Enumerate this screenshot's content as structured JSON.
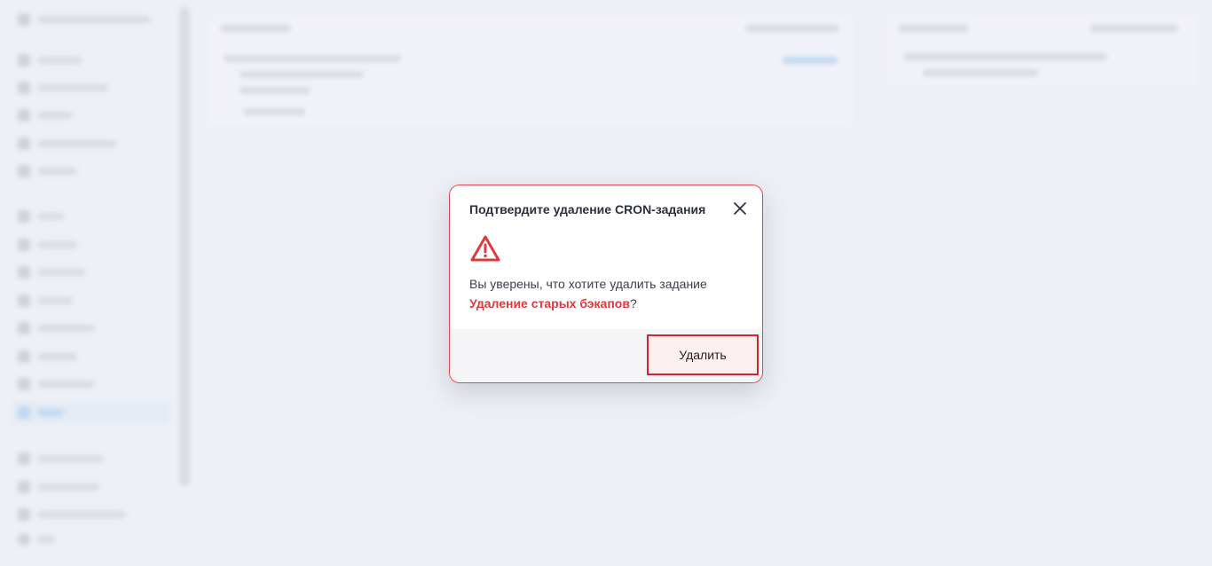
{
  "modal": {
    "title": "Подтвердите удаление CRON-задания",
    "message_prefix": "Вы уверены, что хотите удалить задание",
    "job_name": "Удаление старых бэкапов",
    "message_suffix": "?",
    "delete_label": "Удалить",
    "icons": {
      "close": "close-icon",
      "warning": "warning-icon"
    },
    "colors": {
      "danger": "#e0383c",
      "border": "#e0484c",
      "button_border": "#d3262c"
    }
  }
}
